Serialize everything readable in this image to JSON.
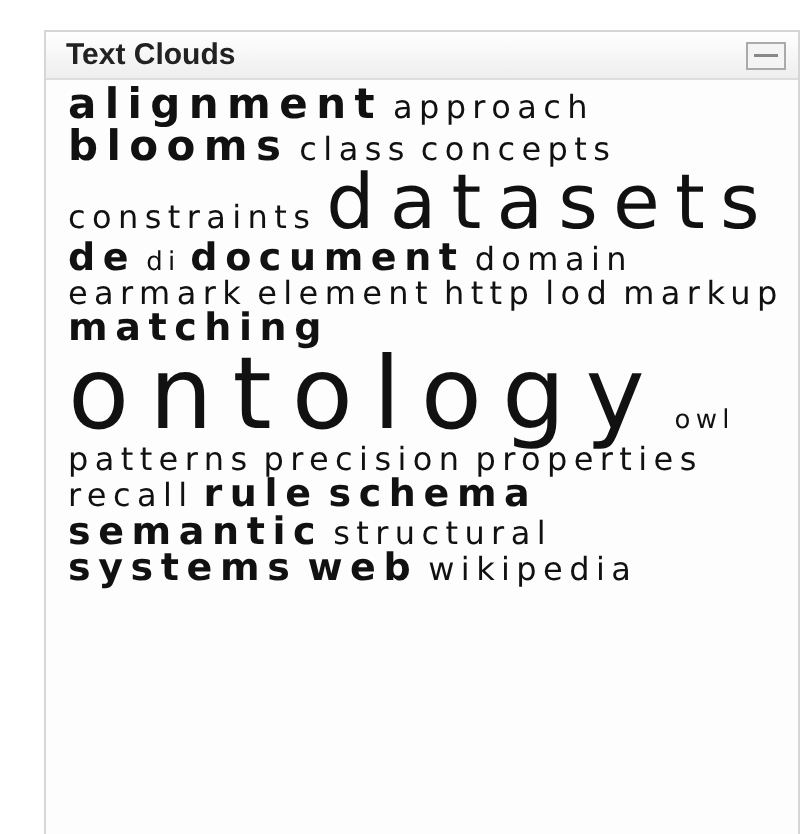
{
  "block": {
    "title": "Text Clouds",
    "words": [
      {
        "text": "alignment",
        "kind": "large"
      },
      {
        "text": "approach",
        "kind": "small"
      },
      {
        "text": "blooms",
        "kind": "large"
      },
      {
        "text": "class",
        "kind": "small"
      },
      {
        "text": "concepts",
        "kind": "small"
      },
      {
        "text": "constraints",
        "kind": "small"
      },
      {
        "text": "datasets",
        "kind": "huge"
      },
      {
        "text": "de",
        "kind": "medium"
      },
      {
        "text": "di",
        "kind": "tiny"
      },
      {
        "text": "document",
        "kind": "medium"
      },
      {
        "text": "domain",
        "kind": "small"
      },
      {
        "text": "earmark",
        "kind": "small"
      },
      {
        "text": "element",
        "kind": "small"
      },
      {
        "text": "http",
        "kind": "small"
      },
      {
        "text": "lod",
        "kind": "small"
      },
      {
        "text": "markup",
        "kind": "small"
      },
      {
        "text": "matching",
        "kind": "medium"
      },
      {
        "text": "ontology",
        "kind": "giant"
      },
      {
        "text": "owl",
        "kind": "tiny"
      },
      {
        "text": "patterns",
        "kind": "small"
      },
      {
        "text": "precision",
        "kind": "small"
      },
      {
        "text": "properties",
        "kind": "small"
      },
      {
        "text": "recall",
        "kind": "small"
      },
      {
        "text": "rule",
        "kind": "medium"
      },
      {
        "text": "schema",
        "kind": "medium"
      },
      {
        "text": "semantic",
        "kind": "medium"
      },
      {
        "text": "structural",
        "kind": "small"
      },
      {
        "text": "systems",
        "kind": "medium"
      },
      {
        "text": "web",
        "kind": "medium"
      },
      {
        "text": "wikipedia",
        "kind": "small"
      }
    ]
  }
}
